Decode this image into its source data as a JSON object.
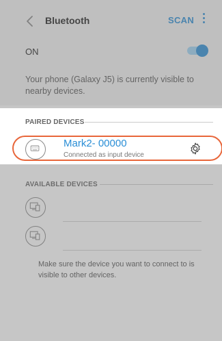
{
  "header": {
    "title": "Bluetooth",
    "scan_label": "SCAN",
    "back_icon": "chevron-left-icon",
    "more_icon": "more-vertical-icon"
  },
  "toggle": {
    "label": "ON",
    "state": "on"
  },
  "visibility_text": "Your phone (Galaxy J5) is currently visible to nearby devices.",
  "paired": {
    "header": "PAIRED DEVICES",
    "devices": [
      {
        "name": "Mark2- 00000",
        "status": "Connected as input device",
        "icon": "keyboard-icon",
        "settings_icon": "gear-icon"
      }
    ]
  },
  "available": {
    "header": "AVAILABLE DEVICES",
    "item_icon": "devices-icon",
    "hint": "Make sure the device you want to connect to is visible to other devices."
  },
  "colors": {
    "accent": "#2a8ed6",
    "highlight": "#e8663a",
    "overlay": "rgba(120,120,120,0.42)"
  }
}
